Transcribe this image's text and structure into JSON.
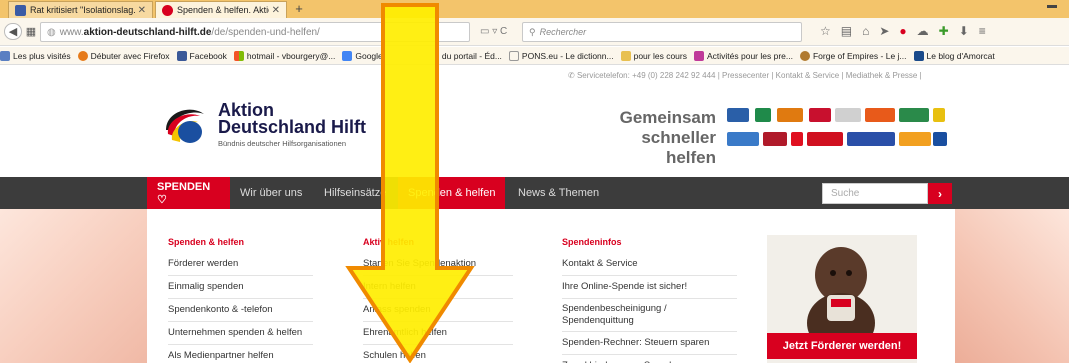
{
  "browser": {
    "tabs": [
      {
        "title": "Rat kritisiert \"Isolationslag...",
        "active": false
      },
      {
        "title": "Spenden & helfen. Aktion ...",
        "active": true
      }
    ],
    "url_prefix": "www.",
    "url_domain": "aktion-deutschland-hilft.de",
    "url_path": "/de/spenden-und-helfen/",
    "search_placeholder": "Rechercher",
    "bookmarks": [
      "Les plus visités",
      "Débuter avec Firefox",
      "Facebook",
      "hotmail - vbourgery@...",
      "Google",
      "il du portail - Éd...",
      "PONS.eu - Le dictionn...",
      "pour les cours",
      "Activités pour les pre...",
      "Forge of Empires - Le j...",
      "Le blog d'Amorcat"
    ]
  },
  "header": {
    "topinfo": "Servicetelefon: +49 (0) 228 242 92 444  |  Pressecenter  |  Kontakt & Service  |  Mediathek & Presse  |",
    "logo_line1": "Aktion",
    "logo_line2": "Deutschland Hilft",
    "logo_sub": "Bündnis deutscher Hilfsorganisationen",
    "slogan_line1": "Gemeinsam",
    "slogan_line2": "schneller helfen"
  },
  "mainnav": {
    "spenden": "SPENDEN ♡",
    "items": [
      "Wir über uns",
      "Hilfseinsätze",
      "Spenden & helfen",
      "News & Themen"
    ],
    "search_placeholder": "Suche"
  },
  "dropdown": {
    "col1": {
      "title": "Spenden & helfen",
      "items": [
        "Förderer werden",
        "Einmalig spenden",
        "Spendenkonto & -telefon",
        "Unternehmen spenden & helfen",
        "Als Medienpartner helfen"
      ]
    },
    "col2": {
      "title": "Aktiv helfen",
      "items": [
        "Starten Sie Spendenaktion",
        "Intern helfen",
        "Anlass spenden",
        "Ehrenamtlich helfen",
        "Schulen helfen"
      ]
    },
    "col3": {
      "title": "Spendeninfos",
      "items": [
        "Kontakt & Service",
        "Ihre Online-Spende ist sicher!",
        "Spendenbescheinigung / Spendenquittung",
        "Spenden-Rechner: Steuern sparen",
        "Zweckbindung von Spenden"
      ]
    },
    "promo_button": "Jetzt Förderer werden!"
  },
  "colors": {
    "brand_red": "#d8001f",
    "nav_dark": "#3c3c3c",
    "arrow_yellow": "#ffee00",
    "arrow_outline": "#f08a00"
  }
}
